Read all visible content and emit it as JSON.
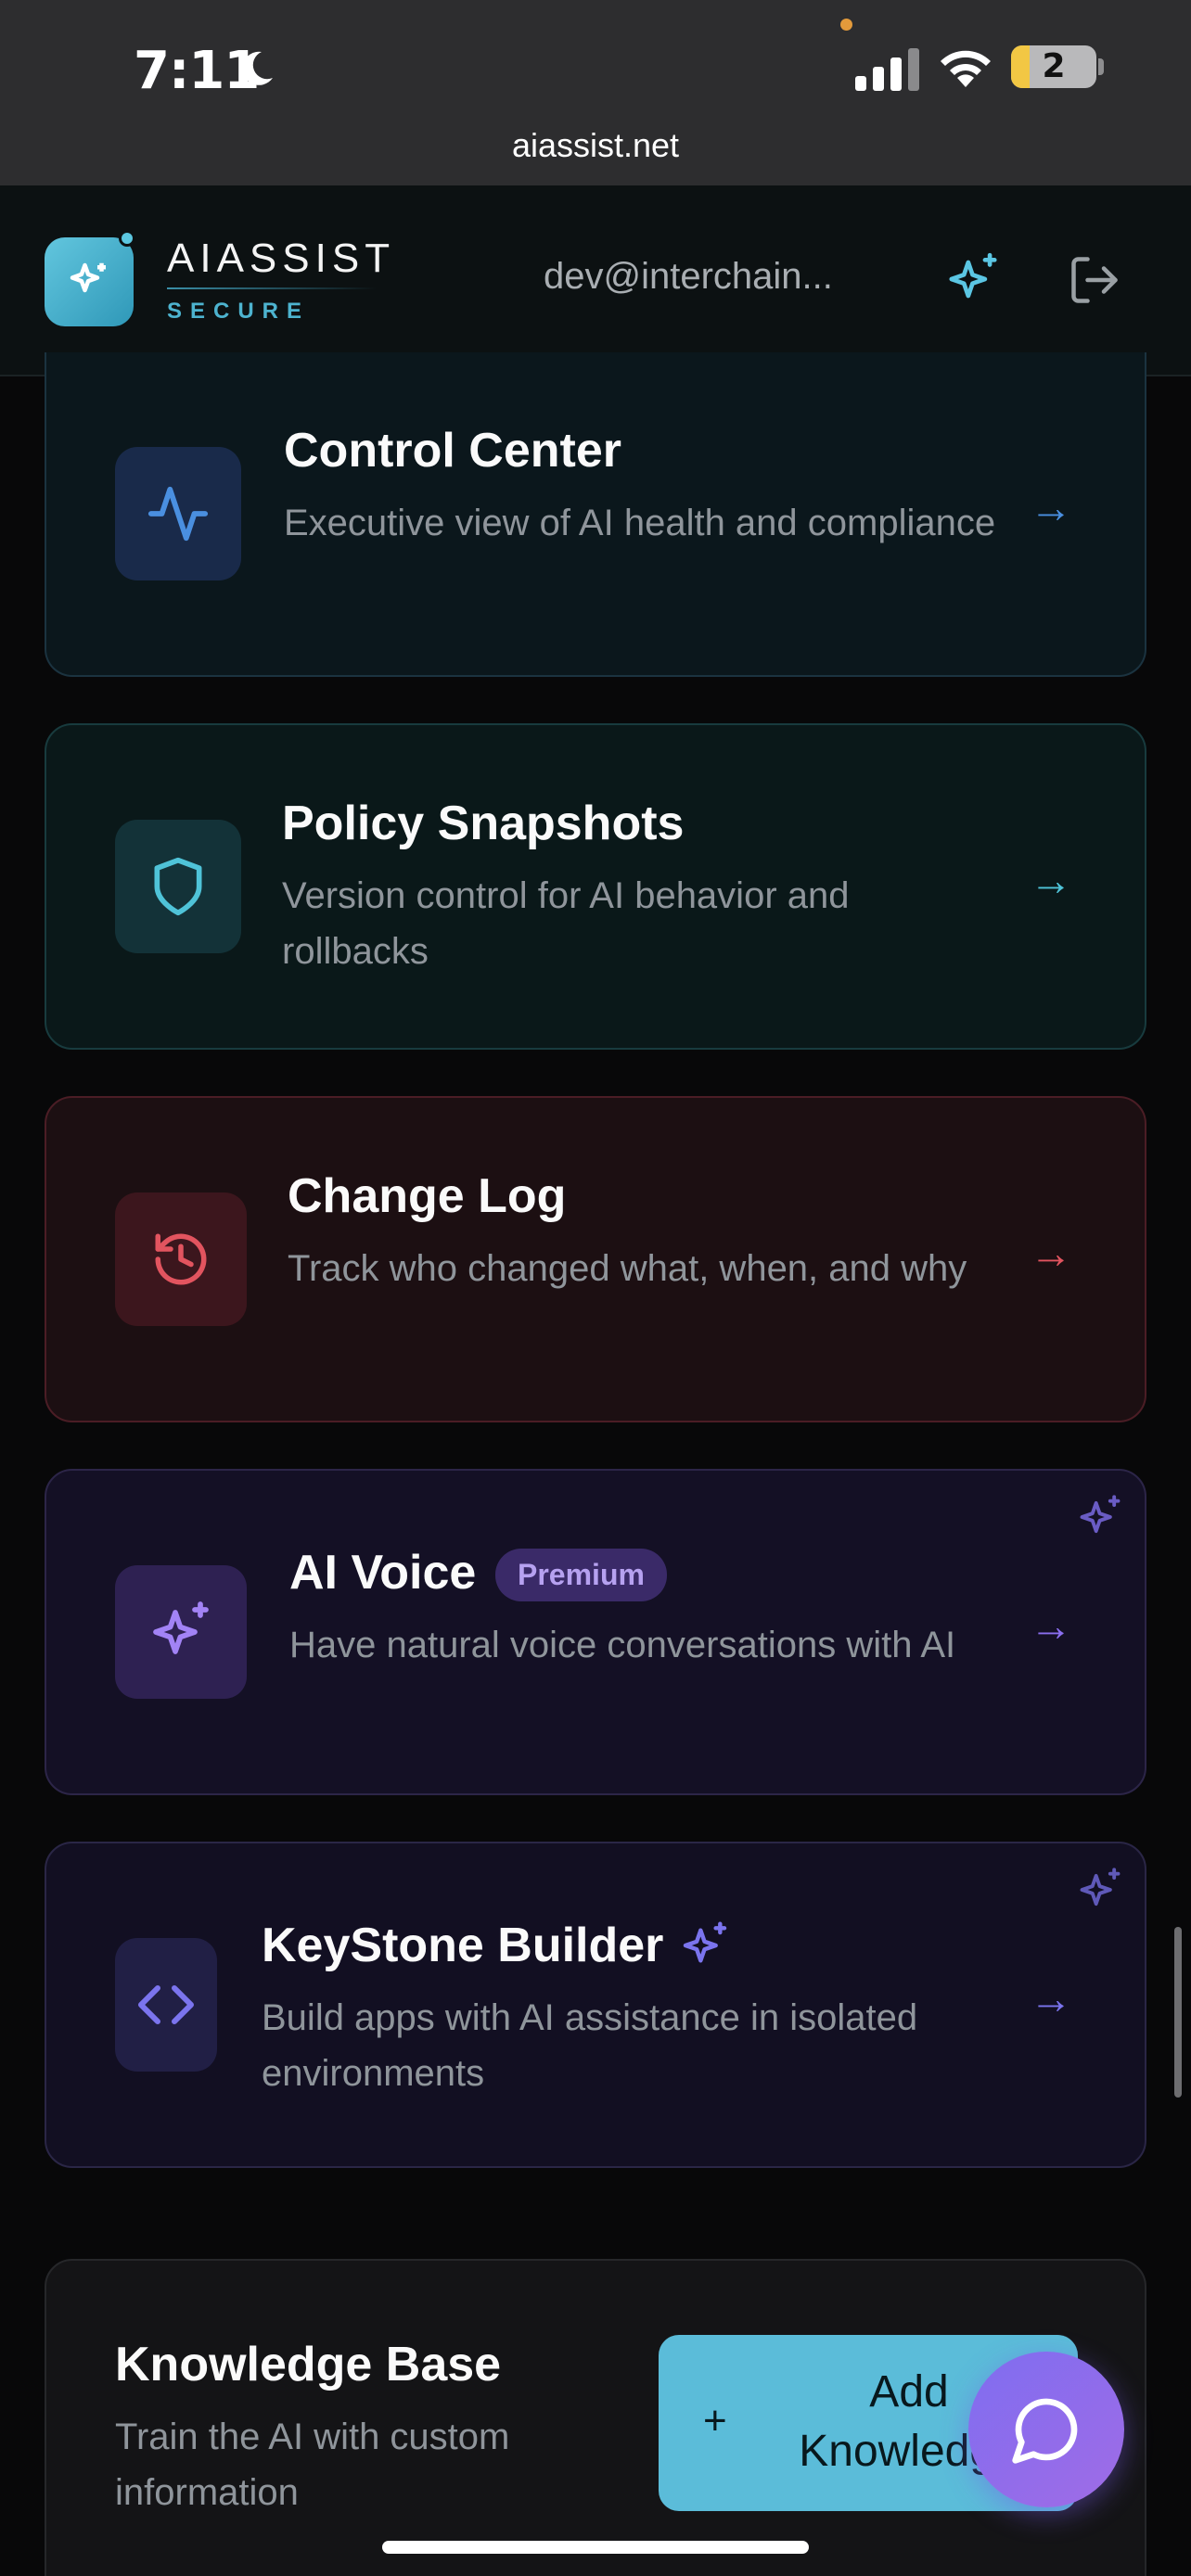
{
  "status_bar": {
    "time": "7:11",
    "battery": "2"
  },
  "browser": {
    "url": "aiassist.net"
  },
  "header": {
    "brand": "AIASSIST",
    "brand_sub": "SECURE",
    "user_email": "dev@interchain..."
  },
  "cards": [
    {
      "title": "Control Center",
      "description": "Executive view of AI health and compliance",
      "icon": "activity-icon",
      "accent": "#4a8fe0"
    },
    {
      "title": "Policy Snapshots",
      "description": "Version control for AI behavior and rollbacks",
      "icon": "shield-icon",
      "accent": "#4fc3d8"
    },
    {
      "title": "Change Log",
      "description": "Track who changed what, when, and why",
      "icon": "history-icon",
      "accent": "#e2545f"
    },
    {
      "title": "AI Voice",
      "badge": "Premium",
      "description": "Have natural voice conversations with AI",
      "icon": "sparkles-icon",
      "accent": "#8b6ff0"
    },
    {
      "title": "KeyStone Builder",
      "description": "Build apps with AI assistance in isolated environments",
      "icon": "code-icon",
      "accent": "#7b74ee"
    }
  ],
  "knowledge_base": {
    "title": "Knowledge Base",
    "description": "Train the AI with custom information",
    "button_label": "Add Knowledge"
  },
  "colors": {
    "brand": "#5bbcd9",
    "premium": "#8b6ff0",
    "danger": "#e2545f"
  }
}
